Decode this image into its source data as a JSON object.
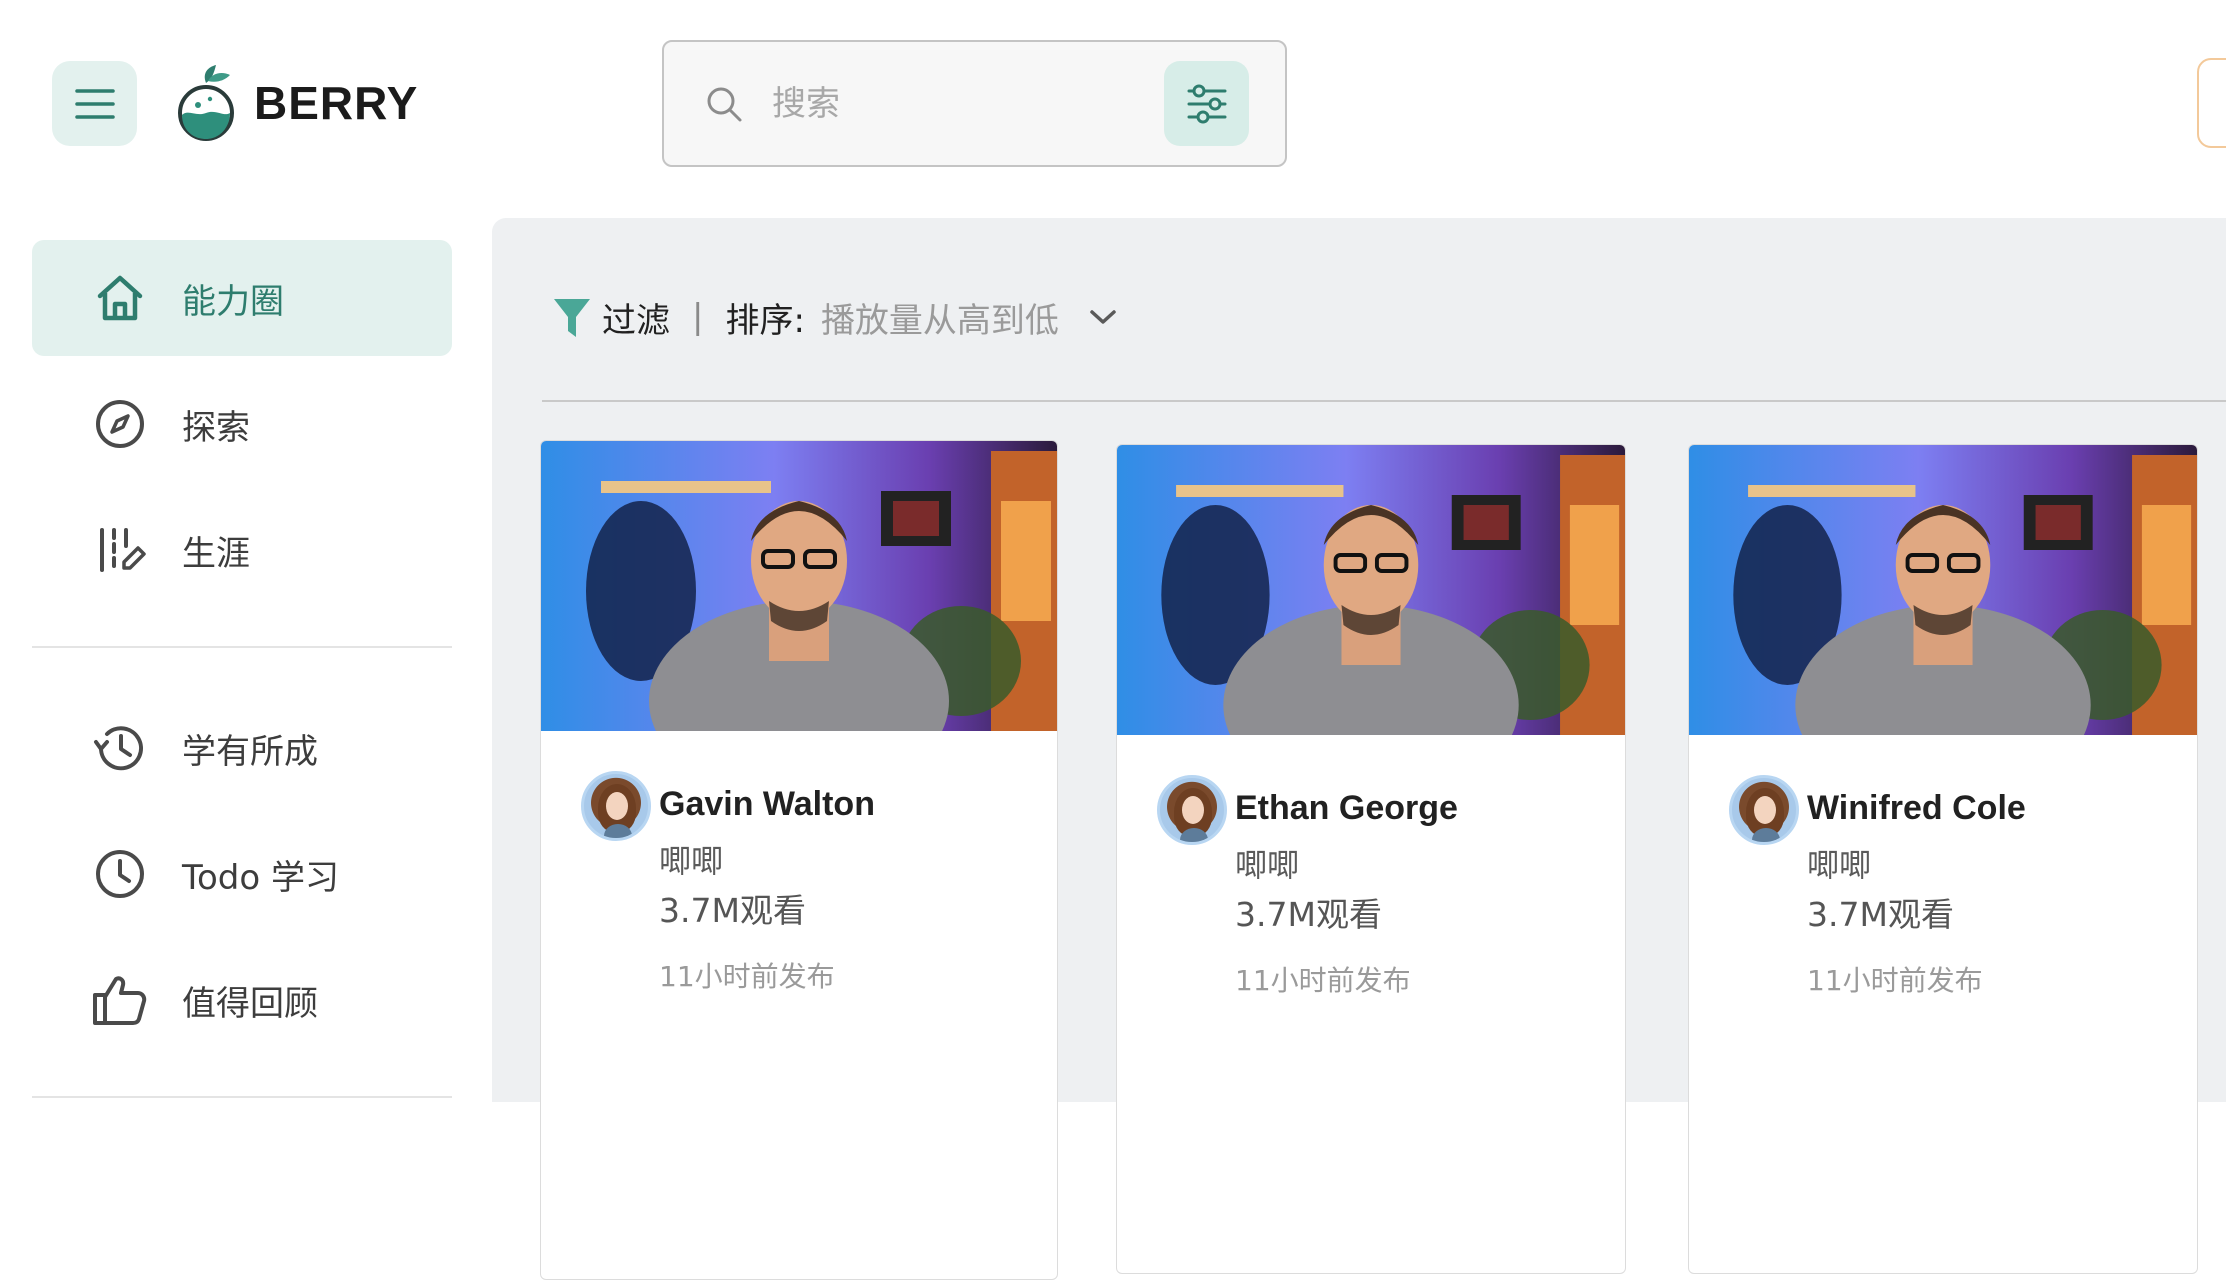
{
  "header": {
    "logo_text": "BERRY",
    "search": {
      "placeholder": "搜索",
      "value": ""
    },
    "colors": {
      "accent": "#2e7d6e",
      "accent_bg": "#e3f1ee"
    }
  },
  "sidebar": {
    "items": [
      {
        "label": "能力圈",
        "icon": "home-icon",
        "active": true
      },
      {
        "label": "探索",
        "icon": "compass-icon",
        "active": false
      },
      {
        "label": "生涯",
        "icon": "career-icon",
        "active": false
      },
      {
        "label": "学有所成",
        "icon": "history-icon",
        "active": false
      },
      {
        "label": "Todo 学习",
        "icon": "clock-icon",
        "active": false
      },
      {
        "label": "值得回顾",
        "icon": "thumbs-up-icon",
        "active": false
      }
    ]
  },
  "toolbar": {
    "filter_label": "过滤",
    "separator": "|",
    "sort_label": "排序:",
    "sort_value": "播放量从高到低"
  },
  "videos": [
    {
      "author": "Gavin Walton",
      "channel": "唧唧",
      "views": "3.7M观看",
      "time": "11小时前发布"
    },
    {
      "author": "Ethan George",
      "channel": "唧唧",
      "views": "3.7M观看",
      "time": "11小时前发布"
    },
    {
      "author": "Winifred Cole",
      "channel": "唧唧",
      "views": "3.7M观看",
      "time": "11小时前发布"
    }
  ]
}
